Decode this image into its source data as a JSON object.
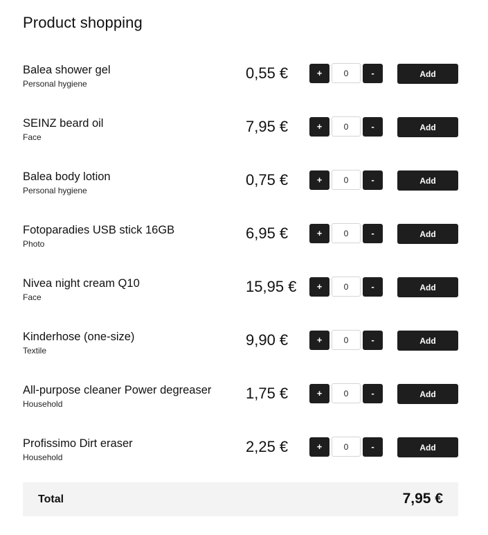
{
  "page": {
    "title": "Product shopping"
  },
  "products": [
    {
      "name": "Balea shower gel",
      "category": "Personal hygiene",
      "price": "0,55 €",
      "quantity": "0"
    },
    {
      "name": "SEINZ beard oil",
      "category": "Face",
      "price": "7,95 €",
      "quantity": "0"
    },
    {
      "name": "Balea body lotion",
      "category": "Personal hygiene",
      "price": "0,75 €",
      "quantity": "0"
    },
    {
      "name": "Fotoparadies USB stick 16GB",
      "category": "Photo",
      "price": "6,95 €",
      "quantity": "0"
    },
    {
      "name": "Nivea night cream Q10",
      "category": "Face",
      "price": "15,95 €",
      "quantity": "0"
    },
    {
      "name": "Kinderhose (one-size)",
      "category": "Textile",
      "price": "9,90 €",
      "quantity": "0"
    },
    {
      "name": "All-purpose cleaner Power degreaser",
      "category": "Household",
      "price": "1,75 €",
      "quantity": "0"
    },
    {
      "name": "Profissimo Dirt eraser",
      "category": "Household",
      "price": "2,25 €",
      "quantity": "0"
    }
  ],
  "controls": {
    "increment_label": "+",
    "decrement_label": "-",
    "add_label": "Add"
  },
  "total": {
    "label": "Total",
    "value": "7,95 €"
  },
  "colors": {
    "button_bg": "#1e1e1e",
    "button_text": "#ffffff",
    "total_bar_bg": "#f3f3f3",
    "input_border": "#d4d4d4"
  }
}
